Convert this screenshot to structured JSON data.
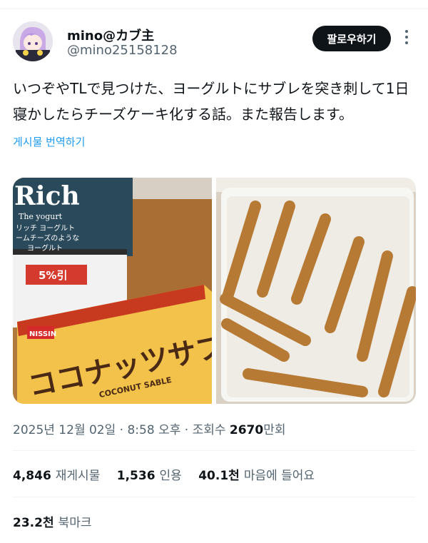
{
  "user": {
    "display_name": "mino@カブ主",
    "handle": "@mino25158128",
    "follow_label": "팔로우하기"
  },
  "tweet": {
    "text_line1": "いつぞやTLで見つけた、ヨーグルトにサブレを突き刺して1日",
    "text_line2": "寝かしたらチーズケーキ化する話。また報告します。",
    "translate_label": "게시물 번역하기"
  },
  "media": {
    "left_image": {
      "yogurt_brand": "Rich",
      "yogurt_sub": "The yogurt",
      "yogurt_jp_1": "リッチ ヨーグルト",
      "yogurt_jp_2": "ームチーズのような",
      "yogurt_jp_3": "ヨーグルト",
      "discount_tag": "5%引",
      "biscuit_maker": "NISSIN",
      "biscuit_name": "ココナッツサブレ",
      "biscuit_en": "COCONUT SABLE"
    }
  },
  "meta": {
    "date": "2025년 12월 02일",
    "sep1": "·",
    "time": "8:58 오후",
    "sep2": "·",
    "views_label": "조회수",
    "views_value": "2670",
    "views_unit": "만회"
  },
  "stats": {
    "reposts_value": "4,846",
    "reposts_label": "재게시물",
    "quotes_value": "1,536",
    "quotes_label": "인용",
    "likes_value": "40.1천",
    "likes_label": "마음에 들어요",
    "bookmarks_value": "23.2천",
    "bookmarks_label": "북마크"
  },
  "colors": {
    "accent": "#1d9bf0",
    "text": "#0f1419",
    "muted": "#536471",
    "follow_bg": "#0f1419"
  }
}
